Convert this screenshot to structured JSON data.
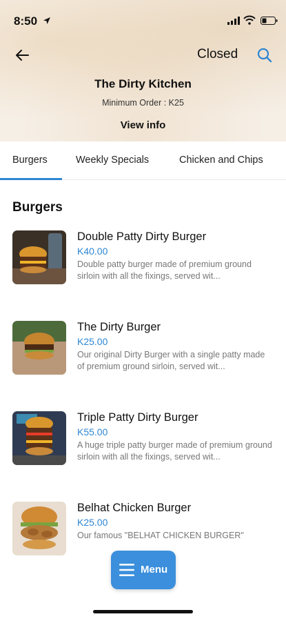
{
  "status_bar": {
    "time": "8:50"
  },
  "header": {
    "status": "Closed",
    "restaurant_name": "The Dirty Kitchen",
    "minimum_order": "Minimum Order : K25",
    "view_info": "View info"
  },
  "tabs": [
    {
      "label": "Burgers",
      "active": true
    },
    {
      "label": "Weekly Specials",
      "active": false
    },
    {
      "label": "Chicken and Chips",
      "active": false
    }
  ],
  "section": {
    "title": "Burgers"
  },
  "items": [
    {
      "name": "Double Patty Dirty Burger",
      "price": "K40.00",
      "description": "Double patty burger made of premium ground sirloin with all the fixings, served wit..."
    },
    {
      "name": "The Dirty Burger",
      "price": "K25.00",
      "description": "Our original Dirty Burger with a single patty made of premium ground sirloin, served wit..."
    },
    {
      "name": "Triple Patty Dirty Burger",
      "price": "K55.00",
      "description": "A huge triple patty burger made of premium ground sirloin with all the fixings, served wit..."
    },
    {
      "name": "Belhat Chicken Burger",
      "price": "K25.00",
      "description": "Our famous \"BELHAT CHICKEN BURGER\""
    }
  ],
  "menu_button": {
    "label": "Menu"
  },
  "colors": {
    "accent": "#2d86d3",
    "menu_button": "#3b8fdc"
  }
}
